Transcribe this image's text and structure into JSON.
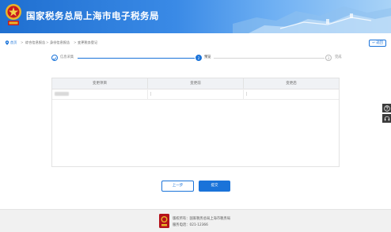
{
  "header": {
    "site_title": "国家税务总局上海市电子税务局"
  },
  "breadcrumb": {
    "items": [
      "首页",
      "综合信息报告",
      "身份信息报告",
      "变更税务登记"
    ],
    "separator": ">"
  },
  "back_button": {
    "label": "返回"
  },
  "steps": [
    {
      "index": "1",
      "label": "信息采集",
      "state": "done"
    },
    {
      "index": "2",
      "label": "预览",
      "state": "active"
    },
    {
      "index": "3",
      "label": "完成",
      "state": "todo"
    }
  ],
  "table": {
    "headers": [
      "变更项目",
      "变更前",
      "变更后"
    ],
    "rows": [
      {
        "item": "",
        "before": "",
        "after": ""
      }
    ]
  },
  "actions": {
    "prev_label": "上一步",
    "submit_label": "提交"
  },
  "side_tools": [
    "help-icon",
    "headset-icon"
  ],
  "footer": {
    "owner": "版权所有：国家税务总局上海市税务局",
    "phone": "服务电话：021-12366"
  },
  "colors": {
    "primary": "#1a73d9",
    "header_start": "#1f6fd0",
    "header_end": "#a9d3f7"
  }
}
